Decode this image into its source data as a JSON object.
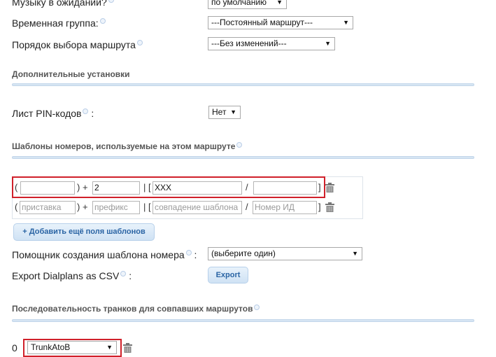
{
  "fields": {
    "hold_music_label": "Музыку в ожидании?",
    "hold_music_value": "по умолчанию",
    "time_group_label": "Временная группа:",
    "time_group_value": "---Постоянный маршрут---",
    "route_order_label": "Порядок выбора маршрута",
    "route_order_value": "---Без изменений---"
  },
  "sections": {
    "additional": "Дополнительные установки",
    "patterns": "Шаблоны номеров, используемые на этом маршруте",
    "trunks": "Последовательность транков для совпавших маршрутов"
  },
  "pin": {
    "label": "Лист PIN-кодов",
    "colon": ":",
    "value": "Нет"
  },
  "patterns": {
    "row1": {
      "prepend_value": "",
      "prefix_value": "2",
      "match_value": "XXX",
      "callerid_value": ""
    },
    "row2": {
      "prepend_placeholder": "приставка",
      "prefix_placeholder": "префикс",
      "match_placeholder": "совпадение шаблона",
      "callerid_placeholder": "Номер ИД"
    },
    "symbols": {
      "open_paren": "(",
      "close_paren_plus": ") +",
      "pipe_bracket": "| [",
      "slash": "/",
      "close_bracket": "]"
    },
    "add_button": "+ Добавить ещё поля шаблонов"
  },
  "wizard": {
    "label": "Помощник создания шаблона номера",
    "colon": ":",
    "value": "(выберите один)"
  },
  "export": {
    "label": "Export Dialplans as CSV",
    "colon": ":",
    "button": "Export"
  },
  "trunk": {
    "index": "0",
    "value": "TrunkAtoB"
  },
  "colors": {
    "highlight": "#d0202a",
    "section_bar": "#d6e5f3",
    "button_text": "#2a64a4"
  }
}
